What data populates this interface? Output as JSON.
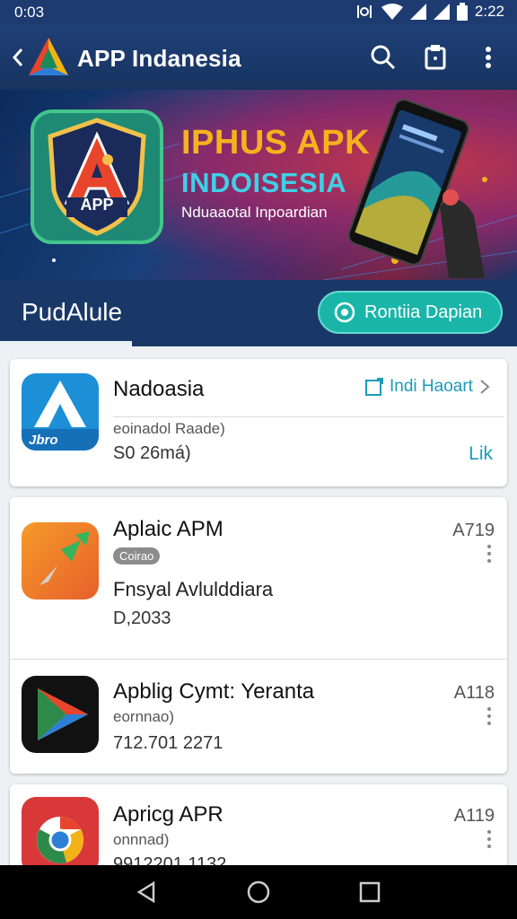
{
  "status": {
    "time": "0:03",
    "clock_right": "2:22"
  },
  "appbar": {
    "title": "APP Indanesia",
    "icons": [
      "back-icon",
      "app-logo",
      "search-icon",
      "clipboard-icon",
      "more-icon"
    ]
  },
  "banner": {
    "badge_text": "APP",
    "headline1": "IPHUS APK",
    "headline2": "INDOISESIA",
    "subtitle": "Nduaaotal Inpoardian"
  },
  "tabs": {
    "active": "PudAlule",
    "action_button": "Rontiia Dapian"
  },
  "apps": [
    {
      "name": "Nadoasia",
      "icon_text": "Jbro",
      "subtitle": "eoinadol Raade)",
      "size": "S0 26má)",
      "install_label": "Indi Haoart",
      "link_label": "Lik"
    },
    {
      "name": "Aplaic APM",
      "tag": "Coirao",
      "publisher": "Fnsyal Avlulddiara",
      "meta": "D,2033",
      "version": "A719"
    },
    {
      "name": "Apblig Cymt: Yeranta",
      "subtitle": "eornnao)",
      "meta": "712.701 2271",
      "version": "A118"
    },
    {
      "name": "Apricg APR",
      "subtitle": "onnnad)",
      "meta": "9912201 1132",
      "version": "A119"
    }
  ],
  "colors": {
    "appbar": "#1f3f78",
    "accent_teal": "#1ab5a9",
    "link": "#1a9bb8"
  }
}
